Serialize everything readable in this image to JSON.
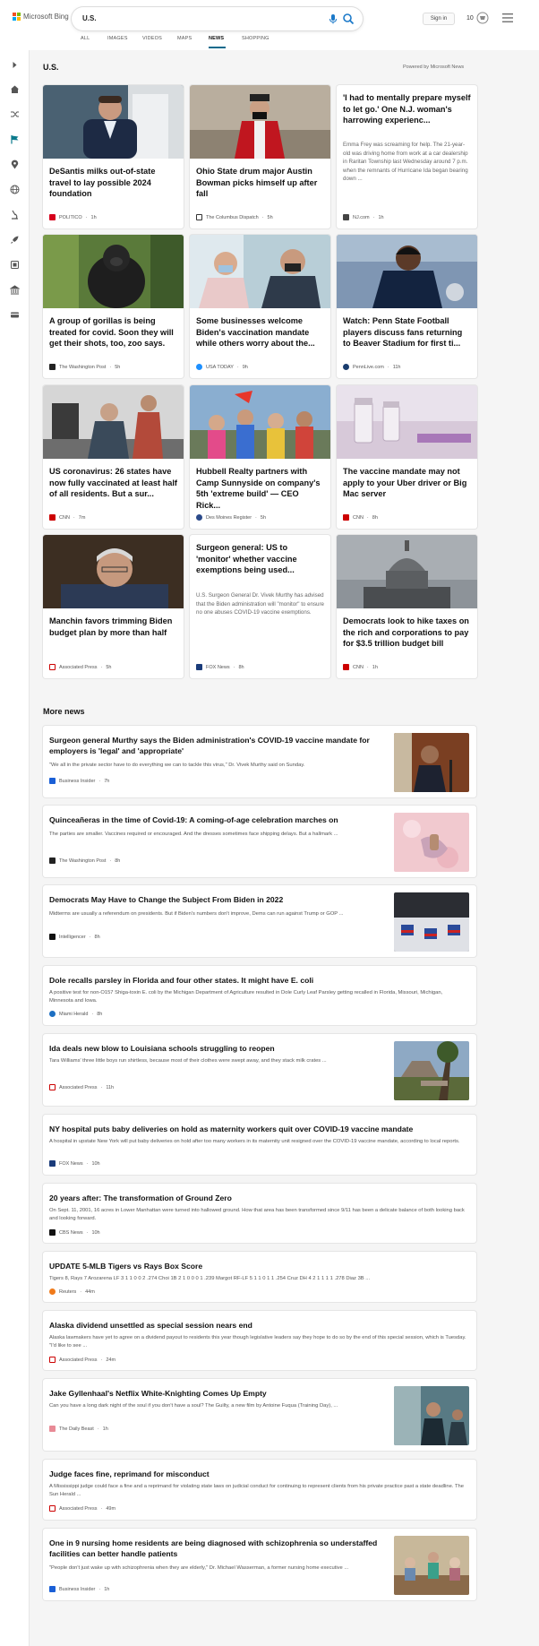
{
  "header": {
    "logo_text": "Microsoft Bing",
    "search_query": "U.S.",
    "signin_label": "Sign in",
    "rewards_count": "10",
    "tabs": [
      {
        "label": "ALL"
      },
      {
        "label": "IMAGES"
      },
      {
        "label": "VIDEOS"
      },
      {
        "label": "MAPS"
      },
      {
        "label": "NEWS",
        "active": true
      },
      {
        "label": "SHOPPING"
      }
    ]
  },
  "rail": {
    "icons": [
      "chevron-right-icon",
      "home-icon",
      "shuffle-icon",
      "flag-icon",
      "location-icon",
      "globe-icon",
      "microscope-icon",
      "rocket-icon",
      "film-icon",
      "bank-icon",
      "card-icon"
    ]
  },
  "section": {
    "title": "U.S.",
    "powered_by": "Powered by Microsoft News"
  },
  "cards": [
    {
      "title": "DeSantis milks out-of-state travel to lay possible 2024 foundation",
      "source": "POLITICO",
      "time": "1h",
      "favicon_color": "#d6001c",
      "thumb": "photo-desantis"
    },
    {
      "title": "Ohio State drum major Austin Bowman picks himself up after fall",
      "source": "The Columbus Dispatch",
      "time": "5h",
      "favicon_color": "#333333",
      "thumb": "photo-drum-major"
    },
    {
      "title": "'I had to mentally prepare myself to let go.' One N.J. woman's harrowing experienc...",
      "snippet": "Emma Frey was screaming for help. The 21-year-old was driving home from work at a car dealership in Raritan Township last Wednesday around 7 p.m. when the remnants of Hurricane Ida began bearing down ...",
      "source": "NJ.com",
      "time": "1h",
      "favicon_color": "#444444"
    },
    {
      "title": "A group of gorillas is being treated for covid. Soon they will get their shots, too, zoo says.",
      "source": "The Washington Post",
      "time": "5h",
      "favicon_color": "#222222",
      "thumb": "photo-gorilla"
    },
    {
      "title": "Some businesses welcome Biden's vaccination mandate while others worry about the...",
      "source": "USA TODAY",
      "time": "9h",
      "favicon_color": "#1e90ff",
      "thumb": "photo-vaccination"
    },
    {
      "title": "Watch: Penn State Football players discuss fans returning to Beaver Stadium for first ti...",
      "source": "PennLive.com",
      "time": "11h",
      "favicon_color": "#1a3d6e",
      "thumb": "photo-football"
    },
    {
      "title": "US coronavirus: 26 states have now fully vaccinated at least half of all residents. But a sur...",
      "source": "CNN",
      "time": "7m",
      "favicon_color": "#cc0000",
      "thumb": "photo-barber"
    },
    {
      "title": "Hubbell Realty partners with Camp Sunnyside on company's 5th 'extreme build' — CEO Rick...",
      "source": "Des Moines Register",
      "time": "5h",
      "favicon_color": "#2b4a8a",
      "thumb": "photo-kids"
    },
    {
      "title": "The vaccine mandate may not apply to your Uber driver or Big Mac server",
      "source": "CNN",
      "time": "8h",
      "favicon_color": "#cc0000",
      "thumb": "photo-vials"
    },
    {
      "title": "Manchin favors trimming Biden budget plan by more than half",
      "source": "Associated Press",
      "time": "5h",
      "favicon_color": "#cc0000",
      "thumb": "photo-manchin"
    },
    {
      "title": "Surgeon general: US to 'monitor' whether vaccine exemptions being used...",
      "snippet": "U.S. Surgeon General Dr. Vivek Murthy has advised that the Biden administration will \"monitor\" to ensure no one abuses COVID-19 vaccine exemptions.",
      "source": "FOX News",
      "time": "8h",
      "favicon_color": "#1a3b7a"
    },
    {
      "title": "Democrats look to hike taxes on the rich and corporations to pay for $3.5 trillion budget bill",
      "source": "CNN",
      "time": "1h",
      "favicon_color": "#cc0000",
      "thumb": "photo-capitol"
    }
  ],
  "more_news": {
    "title": "More news",
    "items": [
      {
        "title": "Surgeon general Murthy says the Biden administration's COVID-19 vaccine mandate for employers is 'legal' and 'appropriate'",
        "snippet": "\"We all in the private sector have to do everything we can to tackle this virus,\" Dr. Vivek Murthy said on Sunday.",
        "source": "Business Insider",
        "time": "7h",
        "favicon_color": "#1a5fd6",
        "thumb": "photo-murthy"
      },
      {
        "title": "Quinceañeras in the time of Covid-19: A coming-of-age celebration marches on",
        "snippet": "The parties are smaller. Vaccines required or encouraged. And the dresses sometimes face shipping delays. But a hallmark ...",
        "source": "The Washington Post",
        "time": "8h",
        "favicon_color": "#222222",
        "thumb": "photo-dress"
      },
      {
        "title": "Democrats May Have to Change the Subject From Biden in 2022",
        "snippet": "Midterms are usually a referendum on presidents. But if Biden's numbers don't improve, Dems can run against Trump or GOP ...",
        "source": "Intelligencer",
        "time": "8h",
        "favicon_color": "#111111",
        "thumb": "photo-voting"
      },
      {
        "title": "Dole recalls parsley in Florida and four other states. It might have E. coli",
        "snippet": "A positive test for non-O157 Shiga-toxin E. coli by the Michigan Department of Agriculture resulted in Dole Curly Leaf Parsley getting recalled in Florida, Missouri, Michigan, Minnesota and Iowa.",
        "source": "Miami Herald",
        "time": "8h",
        "favicon_color": "#1d6fc2"
      },
      {
        "title": "Ida deals new blow to Louisiana schools struggling to reopen",
        "snippet": "Tara Williams' three little boys run shirtless, because most of their clothes were swept away, and they stack milk crates ...",
        "source": "Associated Press",
        "time": "11h",
        "favicon_color": "#cc0000",
        "thumb": "photo-storm"
      },
      {
        "title": "NY hospital puts baby deliveries on hold as maternity workers quit over COVID-19 vaccine mandate",
        "snippet": "A hospital in upstate New York will put baby deliveries on hold after too many workers in its maternity unit resigned over the COVID-19 vaccine mandate, according to local reports.",
        "source": "FOX News",
        "time": "10h",
        "favicon_color": "#1a3b7a"
      },
      {
        "title": "20 years after: The transformation of Ground Zero",
        "snippet": "On Sept. 11, 2001, 16 acres in Lower Manhattan were turned into hallowed ground. How that area has been transformed since 9/11 has been a delicate balance of both looking back and looking forward.",
        "source": "CBS News",
        "time": "10h",
        "favicon_color": "#111111"
      },
      {
        "title": "UPDATE 5-MLB Tigers vs Rays Box Score",
        "snippet": "Tigers 8, Rays 7 Arozarena LF 3 1 1 0 0 2 .274 Choi 1B 2 1 0 0 0 1 .239 Margot RF-LF 5 1 1 0 1 1 .254 Cruz DH 4 2 1 1 1 1 .278 Diaz 3B ...",
        "source": "Reuters",
        "time": "44m",
        "favicon_color": "#f07a1a"
      },
      {
        "title": "Alaska dividend unsettled as special session nears end",
        "snippet": "Alaska lawmakers have yet to agree on a dividend payout to residents this year though legislative leaders say they hope to do so by the end of this special session, which is Tuesday. \"I'd like to see ...",
        "source": "Associated Press",
        "time": "24m",
        "favicon_color": "#cc0000"
      },
      {
        "title": "Jake Gyllenhaal's Netflix White-Knighting Comes Up Empty",
        "snippet": "Can you have a long dark night of the soul if you don't have a soul? The Guilty, a new film by Antoine Fuqua (Training Day), ...",
        "source": "The Daily Beast",
        "time": "1h",
        "favicon_color": "#e88a96",
        "thumb": "photo-gyllenhaal"
      },
      {
        "title": "Judge faces fine, reprimand for misconduct",
        "snippet": "A Mississippi judge could face a fine and a reprimand for violating state laws on judicial conduct for continuing to represent clients from his private practice past a state deadline. The Sun Herald ...",
        "source": "Associated Press",
        "time": "49m",
        "favicon_color": "#cc0000"
      },
      {
        "title": "One in 9 nursing home residents are being diagnosed with schizophrenia so understaffed facilities can better handle patients",
        "snippet": "\"People don't just wake up with schizophrenia when they are elderly,\" Dr. Michael Wasserman, a former nursing home executive ...",
        "source": "Business Insider",
        "time": "1h",
        "favicon_color": "#1a5fd6",
        "thumb": "photo-nursing"
      }
    ]
  }
}
